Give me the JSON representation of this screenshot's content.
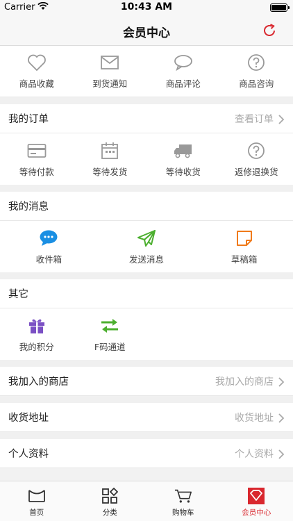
{
  "status": {
    "carrier": "Carrier",
    "time": "10:43 AM"
  },
  "nav": {
    "title": "会员中心"
  },
  "top_grid": [
    {
      "label": "商品收藏",
      "icon": "heart-icon"
    },
    {
      "label": "到货通知",
      "icon": "mail-icon"
    },
    {
      "label": "商品评论",
      "icon": "comment-icon"
    },
    {
      "label": "商品咨询",
      "icon": "question-icon"
    }
  ],
  "orders": {
    "title": "我的订单",
    "link": "查看订单",
    "items": [
      {
        "label": "等待付款",
        "icon": "card-icon"
      },
      {
        "label": "等待发货",
        "icon": "calendar-icon"
      },
      {
        "label": "等待收货",
        "icon": "truck-icon"
      },
      {
        "label": "返修退换货",
        "icon": "question-icon"
      }
    ]
  },
  "messages": {
    "title": "我的消息",
    "items": [
      {
        "label": "收件箱",
        "icon": "inbox-icon",
        "color": "#1a8fe3"
      },
      {
        "label": "发送消息",
        "icon": "send-icon",
        "color": "#4caf2f"
      },
      {
        "label": "草稿箱",
        "icon": "draft-icon",
        "color": "#f07a1a"
      }
    ]
  },
  "other": {
    "title": "其它",
    "items": [
      {
        "label": "我的积分",
        "icon": "gift-icon",
        "color": "#7a4fc4"
      },
      {
        "label": "F码通道",
        "icon": "swap-icon",
        "color": "#4caf2f"
      }
    ]
  },
  "rows": [
    {
      "label": "我加入的商店",
      "value": "我加入的商店"
    },
    {
      "label": "收货地址",
      "value": "收货地址"
    },
    {
      "label": "个人资料",
      "value": "个人资料"
    }
  ],
  "tabs": [
    {
      "label": "首页",
      "icon": "home-icon"
    },
    {
      "label": "分类",
      "icon": "category-icon"
    },
    {
      "label": "购物车",
      "icon": "cart-icon"
    },
    {
      "label": "会员中心",
      "icon": "member-icon",
      "active": true
    }
  ],
  "colors": {
    "accent": "#d9272e",
    "icon_gray": "#999999"
  }
}
